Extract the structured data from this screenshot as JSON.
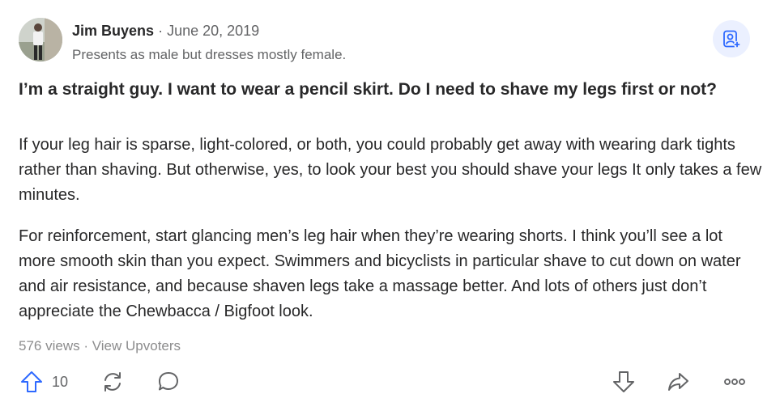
{
  "author": {
    "name": "Jim Buyens",
    "separator": "·",
    "date": "June 20, 2019",
    "credential": "Presents as male but dresses mostly female."
  },
  "question": {
    "title": "I’m a straight guy. I want to wear a pencil skirt. Do I need to shave my legs first or not?"
  },
  "answer": {
    "paragraphs": [
      "If your leg hair is sparse, light-colored, or both, you could probably get away with wearing dark tights rather than shaving. But otherwise, yes, to look your best you should shave your legs It only takes a few minutes.",
      "For reinforcement, start glancing men’s leg hair when they’re wearing shorts. I think you’ll see a lot more smooth skin than you expect. Swimmers and bicyclists in particular shave to cut down on water and air resistance, and because shaven legs take a massage better. And lots of others just don’t appreciate the Chewbacca / Bigfoot look."
    ]
  },
  "stats": {
    "views": "576 views",
    "separator": "·",
    "upvoters_link": "View Upvoters"
  },
  "actions": {
    "upvote_count": "10",
    "icons": {
      "follow": "user-plus-icon",
      "upvote": "arrow-up-icon",
      "share_repost": "refresh-icon",
      "comment": "comment-icon",
      "downvote": "arrow-down-icon",
      "share": "share-arrow-icon",
      "more": "more-dots-icon"
    }
  },
  "colors": {
    "text_primary": "#282829",
    "text_secondary": "#636466",
    "text_muted": "#8c8c8d",
    "accent_blue": "#2e69ff",
    "follow_bg": "#ebf0ff"
  }
}
